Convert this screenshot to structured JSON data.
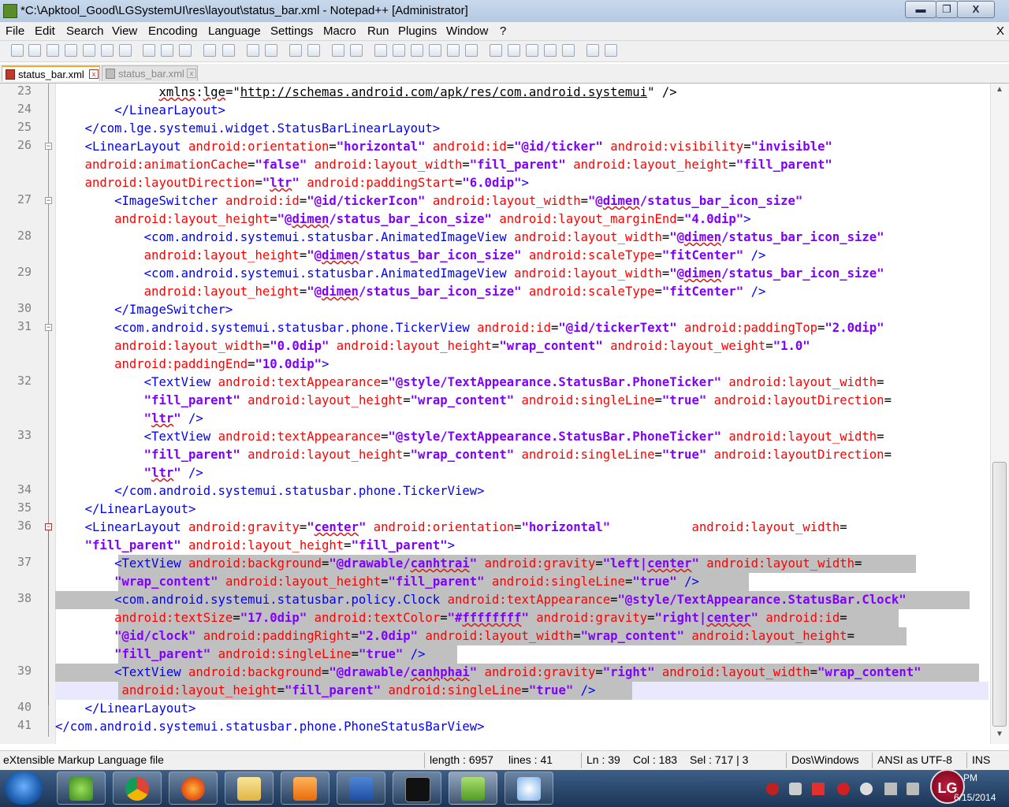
{
  "window": {
    "title": "*C:\\Apktool_Good\\LGSystemUI\\res\\layout\\status_bar.xml - Notepad++ [Administrator]",
    "min": "▬",
    "max": "❐",
    "close": "X"
  },
  "menu": [
    "File",
    "Edit",
    "Search",
    "View",
    "Encoding",
    "Language",
    "Settings",
    "Macro",
    "Run",
    "Plugins",
    "Window",
    "?"
  ],
  "menu_close": "X",
  "tabs": [
    {
      "label": "status_bar.xml",
      "active": true
    },
    {
      "label": "status_bar.xml",
      "active": false
    }
  ],
  "tab_close": "x",
  "statusbar": {
    "filetype": "eXtensible Markup Language file",
    "length": "length : 6957",
    "lines": "lines : 41",
    "ln": "Ln : 39",
    "col": "Col : 183",
    "sel": "Sel : 717 | 3",
    "eol": "Dos\\Windows",
    "encoding": "ANSI as UTF-8",
    "mode": "INS"
  },
  "clock": {
    "time": "PM",
    "date": "6/15/2014"
  },
  "lg_logo": "LG",
  "editor": {
    "line_numbers": [
      "23",
      "24",
      "25",
      "26",
      "27",
      "28",
      "29",
      "30",
      "31",
      "32",
      "33",
      "34",
      "35",
      "36",
      "37",
      "38",
      "39",
      "40",
      "41"
    ]
  }
}
